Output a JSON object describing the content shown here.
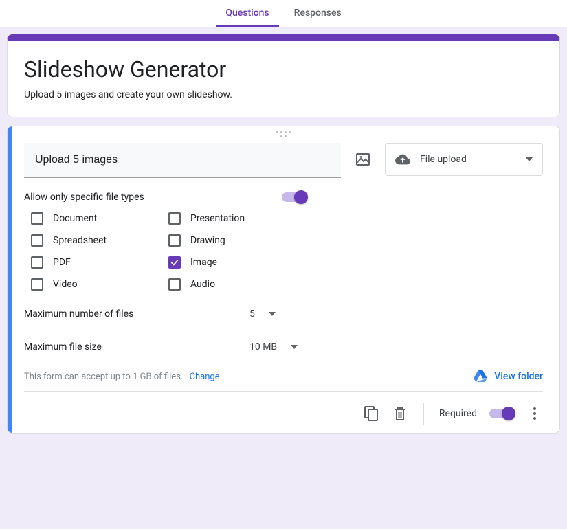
{
  "tabs": {
    "questions": "Questions",
    "responses": "Responses"
  },
  "header": {
    "title": "Slideshow Generator",
    "description": "Upload 5 images and create your own slideshow."
  },
  "question": {
    "title_value": "Upload 5 images",
    "type_label": "File upload",
    "allow_specific_label": "Allow only specific file types",
    "file_types": {
      "document": "Document",
      "spreadsheet": "Spreadsheet",
      "pdf": "PDF",
      "video": "Video",
      "presentation": "Presentation",
      "drawing": "Drawing",
      "image": "Image",
      "audio": "Audio"
    },
    "max_files_label": "Maximum number of files",
    "max_files_value": "5",
    "max_size_label": "Maximum file size",
    "max_size_value": "10 MB",
    "quota_text": "This form can accept up to 1 GB of files.",
    "change_label": "Change",
    "view_folder_label": "View folder",
    "required_label": "Required"
  }
}
